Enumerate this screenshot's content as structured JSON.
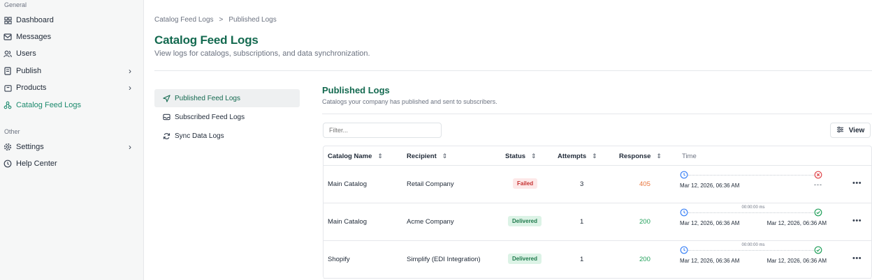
{
  "sidebar": {
    "section_general": "General",
    "section_other": "Other",
    "items": [
      {
        "label": "Dashboard",
        "icon": "dashboard-icon"
      },
      {
        "label": "Messages",
        "icon": "mail-icon"
      },
      {
        "label": "Users",
        "icon": "users-icon"
      },
      {
        "label": "Publish",
        "icon": "publish-icon",
        "has_submenu": true
      },
      {
        "label": "Products",
        "icon": "box-icon",
        "has_submenu": true
      },
      {
        "label": "Catalog Feed Logs",
        "icon": "feed-logs-icon",
        "active": true
      }
    ],
    "other_items": [
      {
        "label": "Settings",
        "icon": "gear-icon",
        "has_submenu": true
      },
      {
        "label": "Help Center",
        "icon": "help-icon"
      }
    ]
  },
  "breadcrumb": {
    "parent": "Catalog Feed Logs",
    "separator": ">",
    "current": "Published Logs"
  },
  "header": {
    "title": "Catalog Feed Logs",
    "subtitle": "View logs for catalogs, subscriptions, and data synchronization."
  },
  "lognav": [
    {
      "label": "Published Feed Logs",
      "icon": "send-icon",
      "active": true
    },
    {
      "label": "Subscribed Feed Logs",
      "icon": "inbox-icon"
    },
    {
      "label": "Sync Data Logs",
      "icon": "sync-icon"
    }
  ],
  "panel": {
    "title": "Published Logs",
    "subtitle": "Catalogs your company has published and sent to subscribers.",
    "filter_placeholder": "Filter...",
    "view_label": "View"
  },
  "table": {
    "columns": [
      "Catalog Name",
      "Recipient",
      "Status",
      "Attempts",
      "Response",
      "Time"
    ],
    "rows": [
      {
        "catalog": "Main Catalog",
        "recipient": "Retail Company",
        "status": "Failed",
        "attempts": "3",
        "response": "405",
        "start": "Mar 12, 2026, 06:36 AM",
        "end": "",
        "duration": "",
        "end_state": "failed"
      },
      {
        "catalog": "Main Catalog",
        "recipient": "Acme Company",
        "status": "Delivered",
        "attempts": "1",
        "response": "200",
        "start": "Mar 12, 2026, 06:36 AM",
        "end": "Mar 12, 2026, 06:36 AM",
        "duration": "00:00:00 ms",
        "end_state": "success"
      },
      {
        "catalog": "Shopify",
        "recipient": "Simplify (EDI Integration)",
        "status": "Delivered",
        "attempts": "1",
        "response": "200",
        "start": "Mar 12, 2026, 06:36 AM",
        "end": "Mar 12, 2026, 06:36 AM",
        "duration": "00:00:00 ms",
        "end_state": "success"
      }
    ]
  },
  "colors": {
    "accent": "#13694f",
    "active_nav": "#1c8a6d",
    "failed": "#c53030",
    "delivered": "#1f7a4c"
  }
}
